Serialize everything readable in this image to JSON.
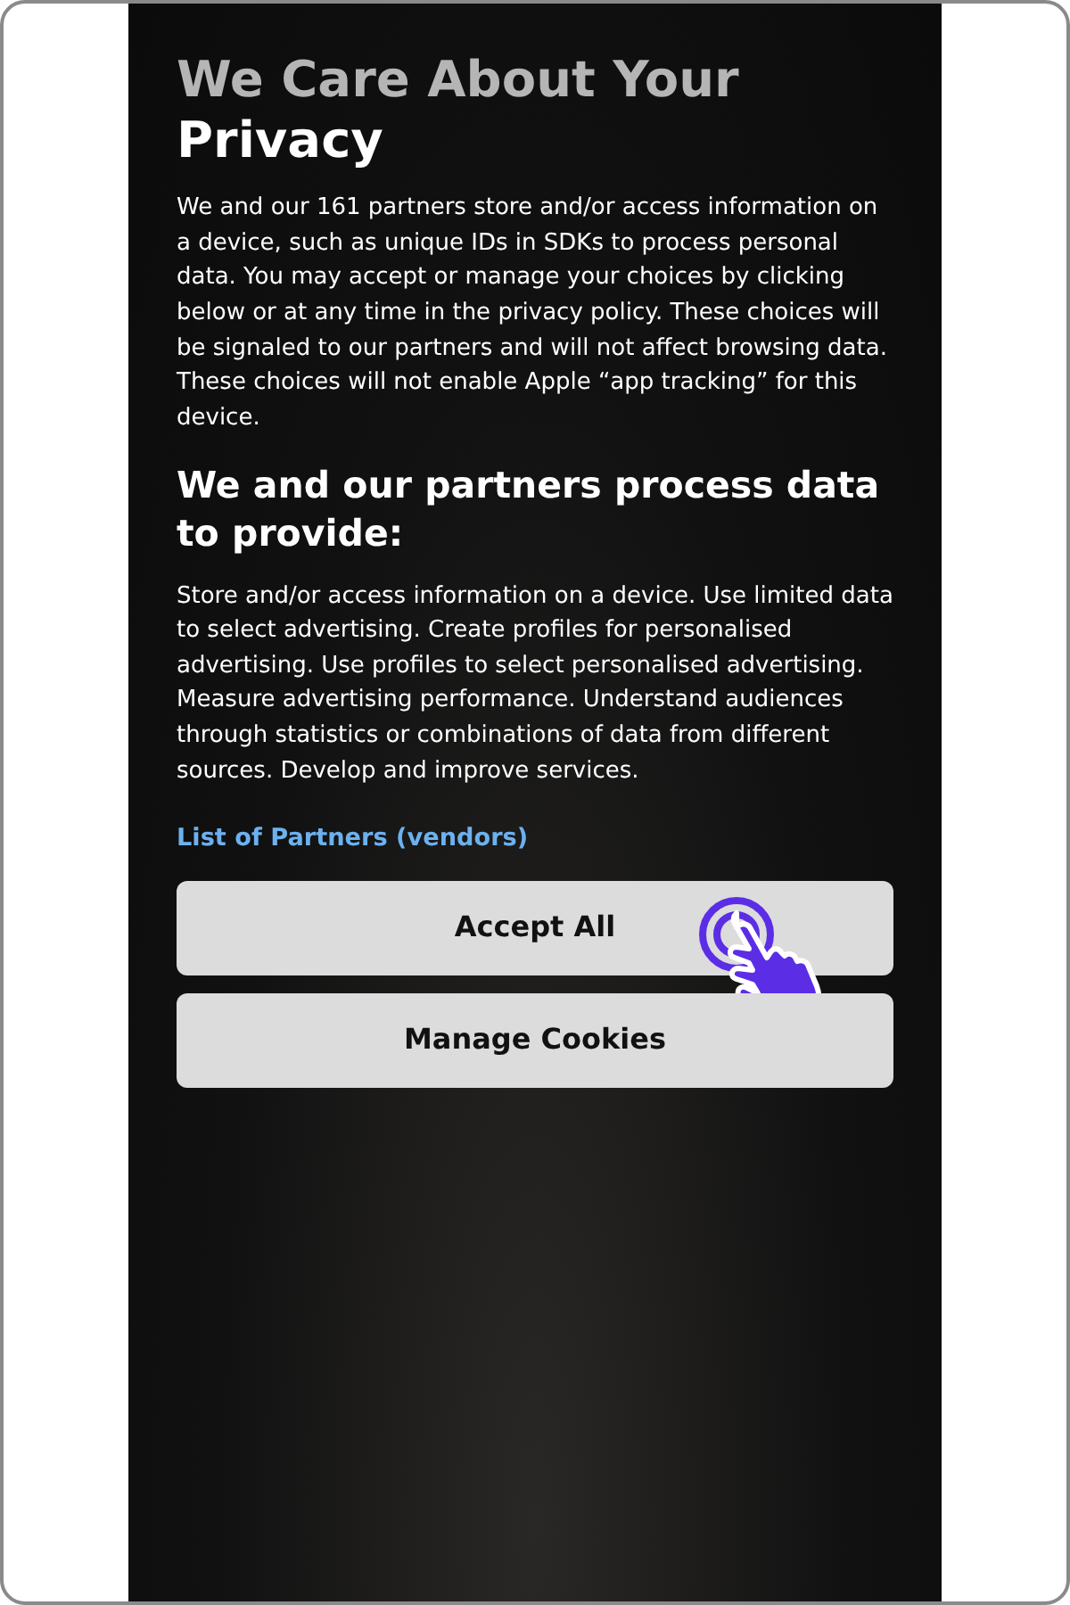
{
  "title": "We Care About Your Privacy",
  "intro": "We and our 161 partners store and/or access information on a device, such as unique IDs in SDKs to process personal data. You may accept or manage your choices by clicking below or at any time in the privacy policy. These choices will be signaled to our partners and will not affect browsing data. These choices will not enable Apple “app tracking” for this device.",
  "purposes_heading": "We and our partners process data to provide:",
  "purposes": "Store and/or access information on a device. Use limited data to select advertising. Create profiles for personalised advertising. Use profiles to select personalised advertising. Measure advertising performance. Understand audiences through statistics or combinations of data from different sources. Develop and improve services.",
  "partners_link": "List of Partners (vendors)",
  "buttons": [
    {
      "label": "Accept All",
      "kind": "accept"
    },
    {
      "label": "Manage Cookies",
      "kind": "manage"
    }
  ]
}
